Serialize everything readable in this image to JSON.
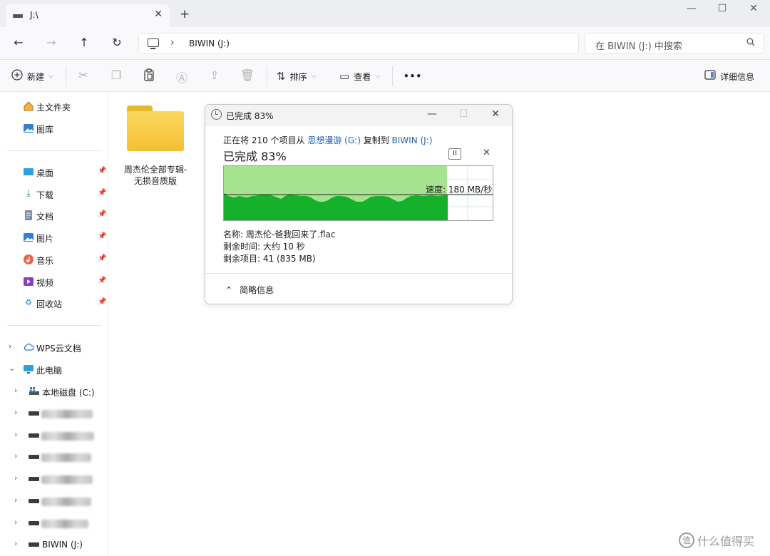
{
  "tab": {
    "title": "J:\\",
    "close": "✕",
    "new": "+"
  },
  "window_controls": {
    "minimize": "—",
    "maximize": "☐",
    "close": "✕"
  },
  "nav": {
    "back": "←",
    "forward": "→",
    "up": "↑",
    "refresh": "↻"
  },
  "address": {
    "chevron": "›",
    "path": "BIWIN (J:)"
  },
  "search": {
    "placeholder": "在 BIWIN (J:) 中搜索"
  },
  "commands": {
    "new": "新建",
    "sort": "排序",
    "view": "查看",
    "more": "•••",
    "details": "详细信息"
  },
  "sidebar": {
    "home": "主文件夹",
    "gallery": "图库",
    "quick": [
      {
        "label": "桌面"
      },
      {
        "label": "下载"
      },
      {
        "label": "文档"
      },
      {
        "label": "图片"
      },
      {
        "label": "音乐"
      },
      {
        "label": "视频"
      },
      {
        "label": "回收站"
      }
    ],
    "wps": "WPS云文档",
    "this_pc": "此电脑",
    "drive_c": "本地磁盘 (C:)",
    "drive_j": "BIWIN (J:)"
  },
  "content": {
    "folder_name_line1": "周杰伦全部专辑-",
    "folder_name_line2": "无损音质版"
  },
  "dialog": {
    "title": "已完成 83%",
    "status_prefix": "正在将 210 个项目从 ",
    "source": "思想漫游 (G:)",
    "status_mid": " 复制到 ",
    "dest": "BIWIN (J:)",
    "percent_text": "已完成 83%",
    "progress": 0.83,
    "speed": "速度: 180 MB/秒",
    "name": "名称: 周杰伦-爸我回来了.flac",
    "time_left": "剩余时间: 大约 10 秒",
    "items_left": "剩余项目: 41 (835 MB)",
    "less_details": "简略信息",
    "pause": "II",
    "cancel": "✕"
  },
  "watermark": {
    "badge": "值",
    "text": "什么值得买"
  }
}
